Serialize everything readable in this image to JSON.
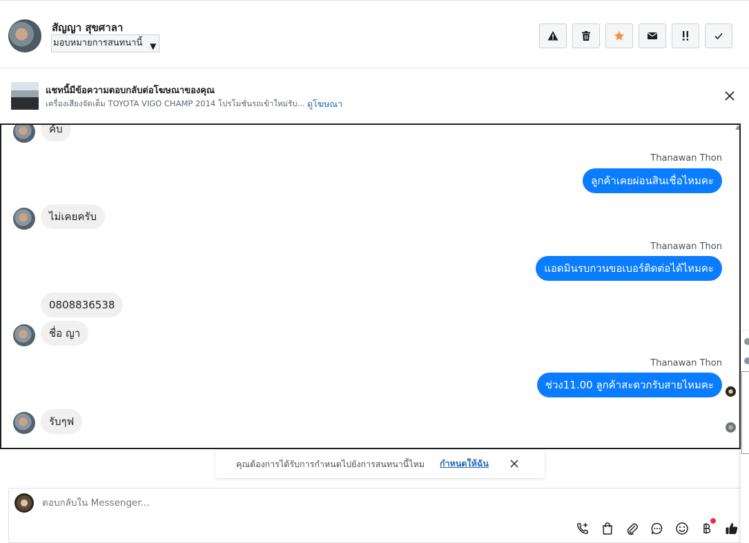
{
  "header": {
    "contact_name": "สัญญา สุขศาลา",
    "assign_label": "มอบหมายการสนทนานี้",
    "actions": [
      {
        "name": "spam",
        "icon": "warning-icon"
      },
      {
        "name": "delete",
        "icon": "trash-icon"
      },
      {
        "name": "star",
        "icon": "star-icon",
        "color": "#f7923b"
      },
      {
        "name": "mark-unread",
        "icon": "envelope-icon"
      },
      {
        "name": "follow-up",
        "icon": "double-exclamation-icon"
      },
      {
        "name": "mark-done",
        "icon": "check-icon"
      }
    ]
  },
  "ad_banner": {
    "title": "แชทนี้มีข้อความตอบกลับต่อโฆษณาของคุณ",
    "description": "เครื่องเสียงจัดเต็ม TOYOTA VIGO CHAMP 2014 โปรโมชั่นรถเข้าใหม่รับ...",
    "link": "ดูโฆษณา"
  },
  "conversation": {
    "messages": [
      {
        "direction": "in",
        "text": "ค้บ"
      },
      {
        "direction": "out",
        "sender": "Thanawan Thon",
        "text": "ลูกค้าเคยผ่อนสินเชื่อไหมคะ"
      },
      {
        "direction": "in",
        "text": "ไม่เคยครับ"
      },
      {
        "direction": "out",
        "sender": "Thanawan Thon",
        "text": "แอดมินรบกวนขอเบอร์ติดต่อได้ไหมคะ"
      },
      {
        "direction": "in",
        "text": "0808836538"
      },
      {
        "direction": "in",
        "text": "ชื่อ  ญา"
      },
      {
        "direction": "out",
        "sender": "Thanawan Thon",
        "text": "ช่วง11.00 ลูกค้าสะดวกรับสายไหมคะ"
      },
      {
        "direction": "in",
        "text": "รับๆฟ"
      }
    ]
  },
  "toast": {
    "text": "คุณต้องการได้รับการกำหนดไปยังการสนทนานี้ไหม",
    "link": "กำหนดให้ฉัน"
  },
  "composer": {
    "placeholder": "ตอบกลับใน Messenger...",
    "tools": [
      "call-icon",
      "shopping-bag-icon",
      "attachment-icon",
      "saved-reply-icon",
      "emoji-icon",
      "baht-payment-icon",
      "thumbs-up-icon"
    ]
  },
  "colors": {
    "accent": "#0a7cff",
    "link": "#1e67b5",
    "incoming_bubble": "#f1f0f0",
    "star": "#f7923b",
    "badge": "#f02849"
  }
}
